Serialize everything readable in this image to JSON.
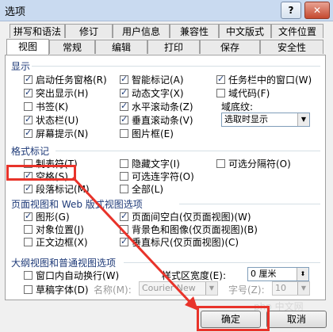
{
  "window": {
    "title": "选项",
    "help": "?",
    "close": "✕"
  },
  "tabs_row1": [
    "拼写和语法",
    "修订",
    "用户信息",
    "兼容性",
    "中文版式",
    "文件位置"
  ],
  "tabs_row2": [
    "视图",
    "常规",
    "编辑",
    "打印",
    "保存",
    "安全性"
  ],
  "active_tab": "视图",
  "sections": {
    "display": "显示",
    "format_marks": "格式标记",
    "page_web": "页面视图和 Web 版式视图选项",
    "outline": "大纲视图和普通视图选项"
  },
  "display": {
    "col1": [
      {
        "label": "启动任务窗格(R)",
        "checked": true
      },
      {
        "label": "突出显示(H)",
        "checked": true
      },
      {
        "label": "书签(K)",
        "checked": false
      },
      {
        "label": "状态栏(U)",
        "checked": true
      },
      {
        "label": "屏幕提示(N)",
        "checked": true
      }
    ],
    "col2": [
      {
        "label": "智能标记(A)",
        "checked": true
      },
      {
        "label": "动态文字(X)",
        "checked": true
      },
      {
        "label": "水平滚动条(Z)",
        "checked": true
      },
      {
        "label": "垂直滚动条(V)",
        "checked": true
      },
      {
        "label": "图片框(E)",
        "checked": false
      }
    ],
    "col3": [
      {
        "label": "任务栏中的窗口(W)",
        "checked": true
      },
      {
        "label": "域代码(F)",
        "checked": false
      }
    ],
    "shading_label": "域底纹:",
    "shading_value": "选取时显示"
  },
  "format": {
    "col1": [
      {
        "label": "制表符(T)",
        "checked": false
      },
      {
        "label": "空格(S)",
        "checked": true
      },
      {
        "label": "段落标记(M)",
        "checked": true
      }
    ],
    "col2": [
      {
        "label": "隐藏文字(I)",
        "checked": false
      },
      {
        "label": "可选连字符(O)",
        "checked": false
      },
      {
        "label": "全部(L)",
        "checked": false
      }
    ],
    "col3": [
      {
        "label": "可选分隔符(O)",
        "checked": false
      }
    ]
  },
  "page": {
    "col1": [
      {
        "label": "图形(G)",
        "checked": true
      },
      {
        "label": "对象位置(J)",
        "checked": false
      },
      {
        "label": "正文边框(X)",
        "checked": false
      }
    ],
    "col2": [
      {
        "label": "页面间空白(仅页面视图)(W)",
        "checked": true
      },
      {
        "label": "背景色和图像(仅页面视图)(B)",
        "checked": false
      },
      {
        "label": "垂直标尺(仅页面视图)(C)",
        "checked": true
      }
    ]
  },
  "outline": {
    "wrap": {
      "label": "窗口内自动换行(W)",
      "checked": false
    },
    "draft": {
      "label": "草稿字体(D)",
      "checked": false
    },
    "name_label": "名称(M):",
    "font_value": "Courier New",
    "size_label": "字号(Z):",
    "size_value": "10",
    "width_label": "样式区宽度(E):",
    "width_value": "0 厘米"
  },
  "buttons": {
    "ok": "确定",
    "cancel": "取消"
  },
  "watermark": "php 中文网",
  "colors": {
    "highlight": "#e8332a",
    "arrow": "#e8332a"
  }
}
